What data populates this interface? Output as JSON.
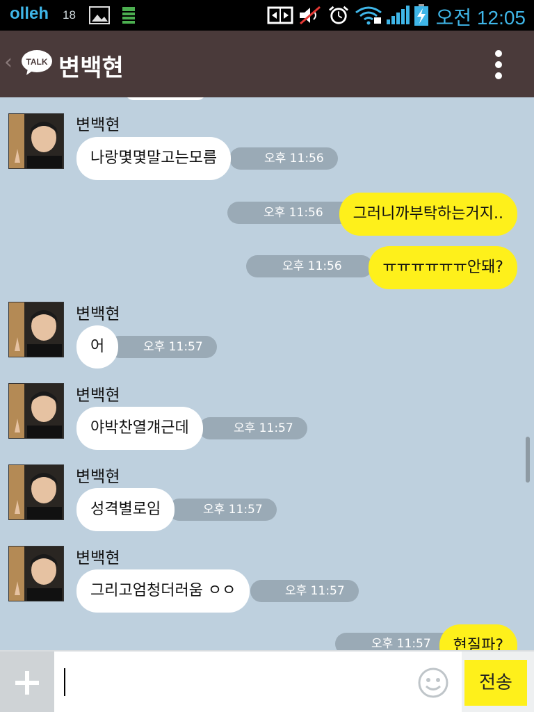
{
  "status_bar": {
    "carrier": "olleh",
    "notification_count": "18",
    "icons": [
      "image-icon",
      "sim-card-icon",
      "screen-mirror-icon",
      "mute-icon",
      "alarm-icon",
      "wifi-icon",
      "signal-icon",
      "battery-charging-icon"
    ],
    "clock": "오전 12:05"
  },
  "header": {
    "back_glyph": "‹",
    "logo_text": "TALK",
    "title": "변백현",
    "menu_icon": "more-vertical-icon"
  },
  "messages": [
    {
      "side": "in",
      "sender": "변백현",
      "text": "나랑몇몇말고는모름",
      "time": "오후 11:56"
    },
    {
      "side": "out",
      "text": "그러니까부탁하는거지..",
      "time": "오후 11:56"
    },
    {
      "side": "out",
      "text": "ㅠㅠㅠㅠㅠㅠ안돼?",
      "time": "오후 11:56"
    },
    {
      "side": "in",
      "sender": "변백현",
      "text": "어",
      "time": "오후 11:57"
    },
    {
      "side": "in",
      "sender": "변백현",
      "text": "야박찬열걔근데",
      "time": "오후 11:57"
    },
    {
      "side": "in",
      "sender": "변백현",
      "text": "성격별로임",
      "time": "오후 11:57"
    },
    {
      "side": "in",
      "sender": "변백현",
      "text": "그리고엄청더러움 ㅇㅇ",
      "time": "오후 11:57"
    },
    {
      "side": "out",
      "text": "현질파?",
      "time": "오후 11:57"
    }
  ],
  "input_bar": {
    "plus_icon": "plus-icon",
    "input_value": "",
    "emoji_icon": "smiley-icon",
    "send_label": "전송"
  },
  "colors": {
    "chat_background": "#bed0de",
    "header_background": "#4a3a3a",
    "outgoing_bubble": "#fef01b",
    "incoming_bubble": "#ffffff",
    "time_pill": "#9aaab6",
    "accent_blue": "#3fb6e8"
  }
}
